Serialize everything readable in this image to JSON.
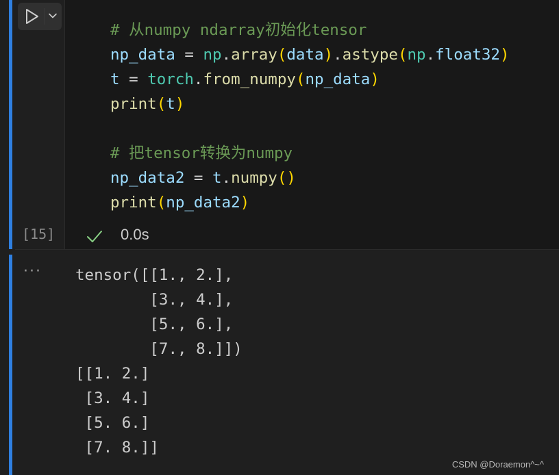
{
  "cell": {
    "execution_count": "[15]",
    "status_time": "0.0s",
    "code_lines": [
      [
        {
          "t": "# 从numpy ndarray初始化tensor",
          "c": "#6a9955"
        }
      ],
      [
        {
          "t": "np_data",
          "c": "#9cdcfe"
        },
        {
          "t": " = ",
          "c": "#d4d4d4"
        },
        {
          "t": "np",
          "c": "#4ec9b0"
        },
        {
          "t": ".",
          "c": "#d4d4d4"
        },
        {
          "t": "array",
          "c": "#dcdcaa"
        },
        {
          "t": "(",
          "c": "#ffd700"
        },
        {
          "t": "data",
          "c": "#9cdcfe"
        },
        {
          "t": ")",
          "c": "#ffd700"
        },
        {
          "t": ".",
          "c": "#d4d4d4"
        },
        {
          "t": "astype",
          "c": "#dcdcaa"
        },
        {
          "t": "(",
          "c": "#ffd700"
        },
        {
          "t": "np",
          "c": "#4ec9b0"
        },
        {
          "t": ".",
          "c": "#d4d4d4"
        },
        {
          "t": "float32",
          "c": "#9cdcfe"
        },
        {
          "t": ")",
          "c": "#ffd700"
        }
      ],
      [
        {
          "t": "t",
          "c": "#9cdcfe"
        },
        {
          "t": " = ",
          "c": "#d4d4d4"
        },
        {
          "t": "torch",
          "c": "#4ec9b0"
        },
        {
          "t": ".",
          "c": "#d4d4d4"
        },
        {
          "t": "from_numpy",
          "c": "#dcdcaa"
        },
        {
          "t": "(",
          "c": "#ffd700"
        },
        {
          "t": "np_data",
          "c": "#9cdcfe"
        },
        {
          "t": ")",
          "c": "#ffd700"
        }
      ],
      [
        {
          "t": "print",
          "c": "#dcdcaa"
        },
        {
          "t": "(",
          "c": "#ffd700"
        },
        {
          "t": "t",
          "c": "#9cdcfe"
        },
        {
          "t": ")",
          "c": "#ffd700"
        }
      ],
      [],
      [
        {
          "t": "# 把tensor转换为numpy",
          "c": "#6a9955"
        }
      ],
      [
        {
          "t": "np_data2",
          "c": "#9cdcfe"
        },
        {
          "t": " = ",
          "c": "#d4d4d4"
        },
        {
          "t": "t",
          "c": "#9cdcfe"
        },
        {
          "t": ".",
          "c": "#d4d4d4"
        },
        {
          "t": "numpy",
          "c": "#dcdcaa"
        },
        {
          "t": "()",
          "c": "#ffd700"
        }
      ],
      [
        {
          "t": "print",
          "c": "#dcdcaa"
        },
        {
          "t": "(",
          "c": "#ffd700"
        },
        {
          "t": "np_data2",
          "c": "#9cdcfe"
        },
        {
          "t": ")",
          "c": "#ffd700"
        }
      ]
    ]
  },
  "output": {
    "ellipsis": "···",
    "lines": [
      "tensor([[1., 2.],",
      "        [3., 4.],",
      "        [5., 6.],",
      "        [7., 8.]])",
      "[[1. 2.]",
      " [3. 4.]",
      " [5. 6.]",
      " [7. 8.]]"
    ]
  },
  "watermark": "CSDN @Doraemon^~^",
  "icons": {
    "run": "play-icon",
    "run_options": "chevron-down-icon",
    "status": "check-icon"
  },
  "colors": {
    "accent_bar": "#2f7fe0",
    "success": "#89d185"
  }
}
